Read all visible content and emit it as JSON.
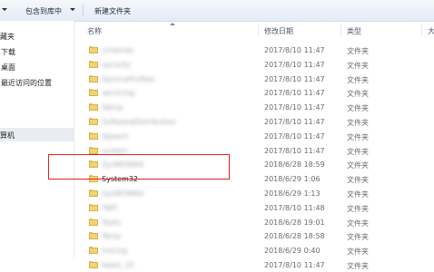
{
  "toolbar": {
    "organize_arrow": "▾",
    "include_in_library": "包含到库中",
    "new_folder": "新建文件夹"
  },
  "nav": {
    "favorites": "收藏夹",
    "downloads": "下载",
    "desktop": "桌面",
    "recent_places": "最近访问的位置",
    "computer": "计算机"
  },
  "columns": {
    "name": "名称",
    "date_modified": "修改日期",
    "type": "类型",
    "size": "大"
  },
  "rows": [
    {
      "name": "schemas",
      "date": "2017/8/10 11:47",
      "type": "文件夹"
    },
    {
      "name": "security",
      "date": "2017/8/10 11:47",
      "type": "文件夹"
    },
    {
      "name": "ServiceProfiles",
      "date": "2017/8/10 11:47",
      "type": "文件夹"
    },
    {
      "name": "servicing",
      "date": "2017/8/10 11:47",
      "type": "文件夹"
    },
    {
      "name": "Setup",
      "date": "2017/8/10 11:47",
      "type": "文件夹"
    },
    {
      "name": "SoftwareDistribution",
      "date": "2017/8/10 11:47",
      "type": "文件夹"
    },
    {
      "name": "Speech",
      "date": "2017/8/10 11:47",
      "type": "文件夹"
    },
    {
      "name": "system",
      "date": "2017/8/10 11:47",
      "type": "文件夹"
    },
    {
      "name": "SysWOW64",
      "date": "2018/6/28 18:59",
      "type": "文件夹"
    },
    {
      "name": "System32",
      "date": "2018/6/29 1:06",
      "type": "文件夹"
    },
    {
      "name": "SysWOW64",
      "date": "2018/6/29 1:13",
      "type": "文件夹"
    },
    {
      "name": "TAPI",
      "date": "2017/8/10 11:48",
      "type": "文件夹"
    },
    {
      "name": "Tasks",
      "date": "2018/6/28 19:01",
      "type": "文件夹"
    },
    {
      "name": "Temp",
      "date": "2018/6/28 18:58",
      "type": "文件夹"
    },
    {
      "name": "tracing",
      "date": "2018/6/29 0:40",
      "type": "文件夹"
    },
    {
      "name": "twain_32",
      "date": "2017/8/10 11:47",
      "type": "文件夹"
    }
  ],
  "highlighted_item": "System32",
  "colors": {
    "highlight_border": "#e02020",
    "folder": "#f2d373"
  }
}
